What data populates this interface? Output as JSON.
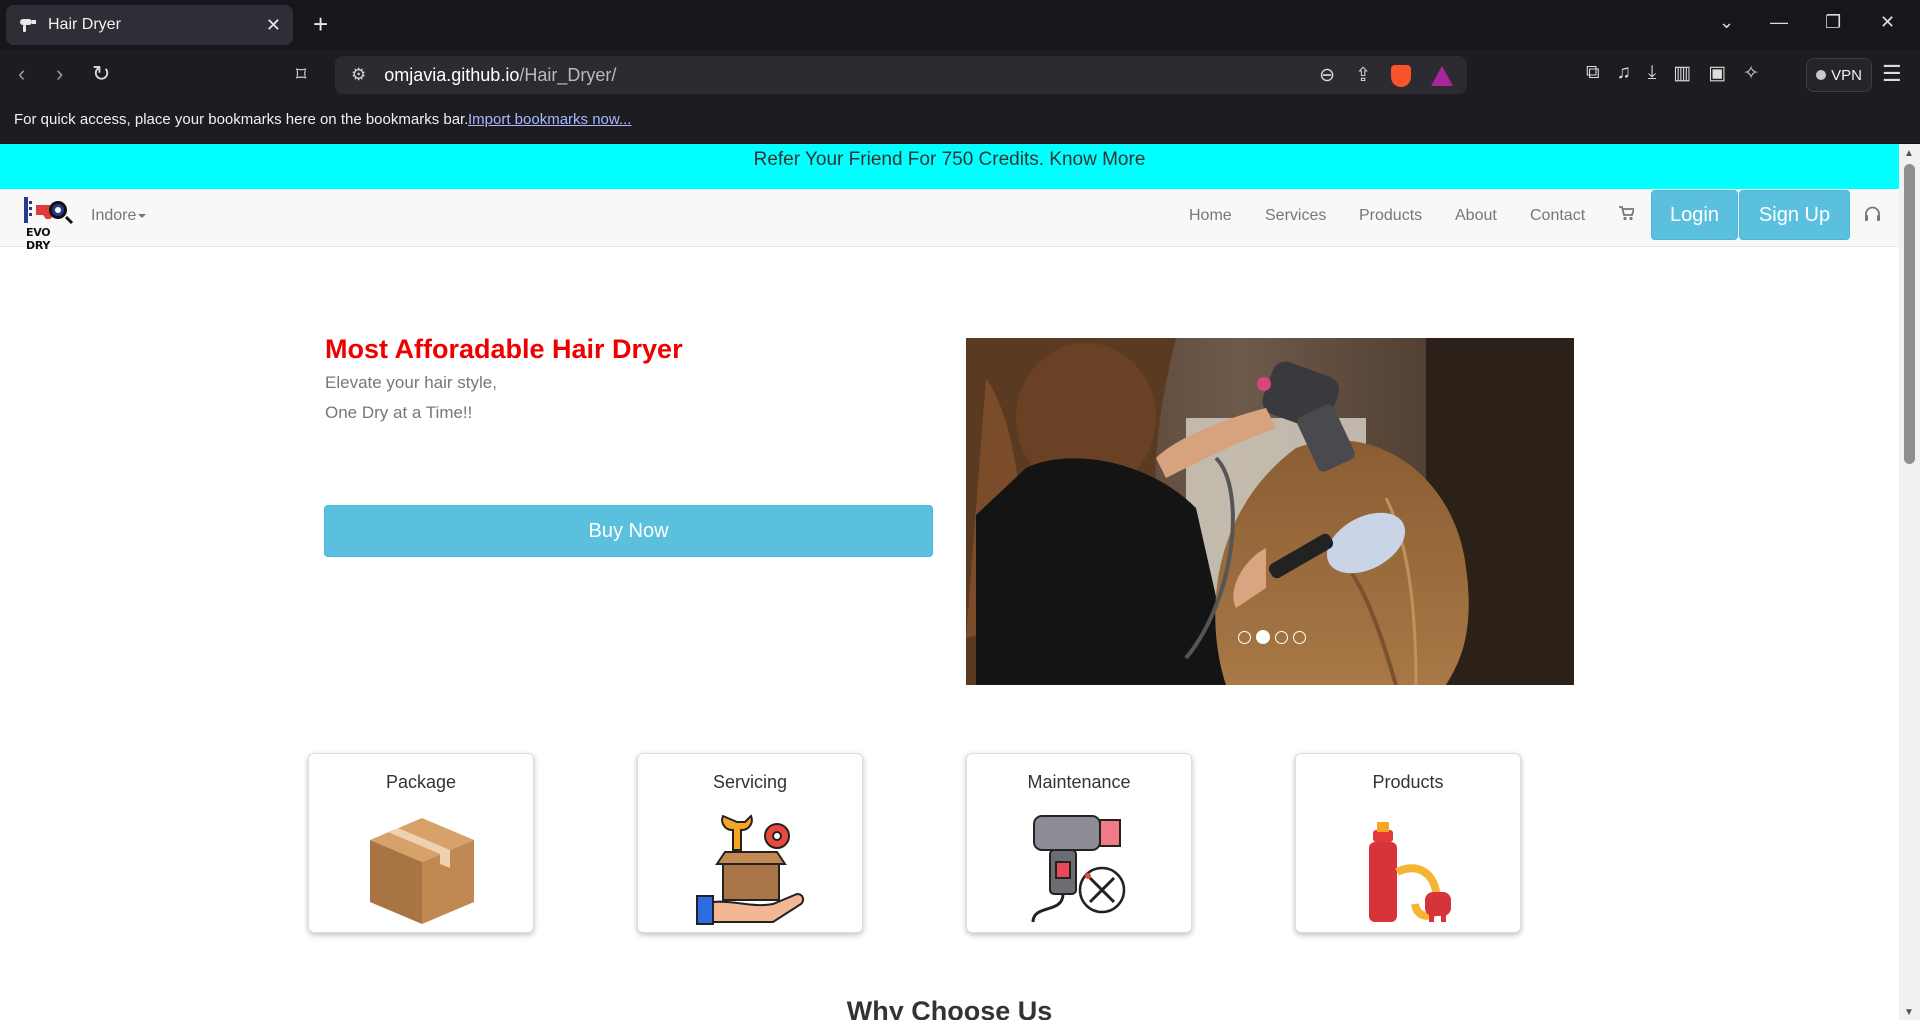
{
  "browser": {
    "tab_title": "Hair Dryer",
    "url_host": "omjavia.github.io",
    "url_path": "/Hair_Dryer/",
    "vpn_label": "VPN",
    "bookmarks_message": "For quick access, place your bookmarks here on the bookmarks bar.",
    "bookmarks_import": "Import bookmarks now..."
  },
  "page": {
    "promo": "Refer Your Friend For 750 Credits. Know More",
    "logo_text": "EVO DRY",
    "city": "Indore",
    "nav": [
      "Home",
      "Services",
      "Products",
      "About",
      "Contact"
    ],
    "login": "Login",
    "signup": "Sign Up",
    "hero": {
      "title": "Most Afforadable Hair Dryer",
      "line1": "Elevate your hair style,",
      "line2": "One Dry at a Time!!",
      "button": "Buy Now"
    },
    "carousel": {
      "slide_count": 4,
      "active_index": 1
    },
    "cards": [
      "Package",
      "Servicing",
      "Maintenance",
      "Products"
    ],
    "why_title": "Why Choose Us"
  },
  "colors": {
    "promo_bg": "#00ffff",
    "accent_button": "#5bc0de",
    "hero_title": "#ee0000"
  }
}
